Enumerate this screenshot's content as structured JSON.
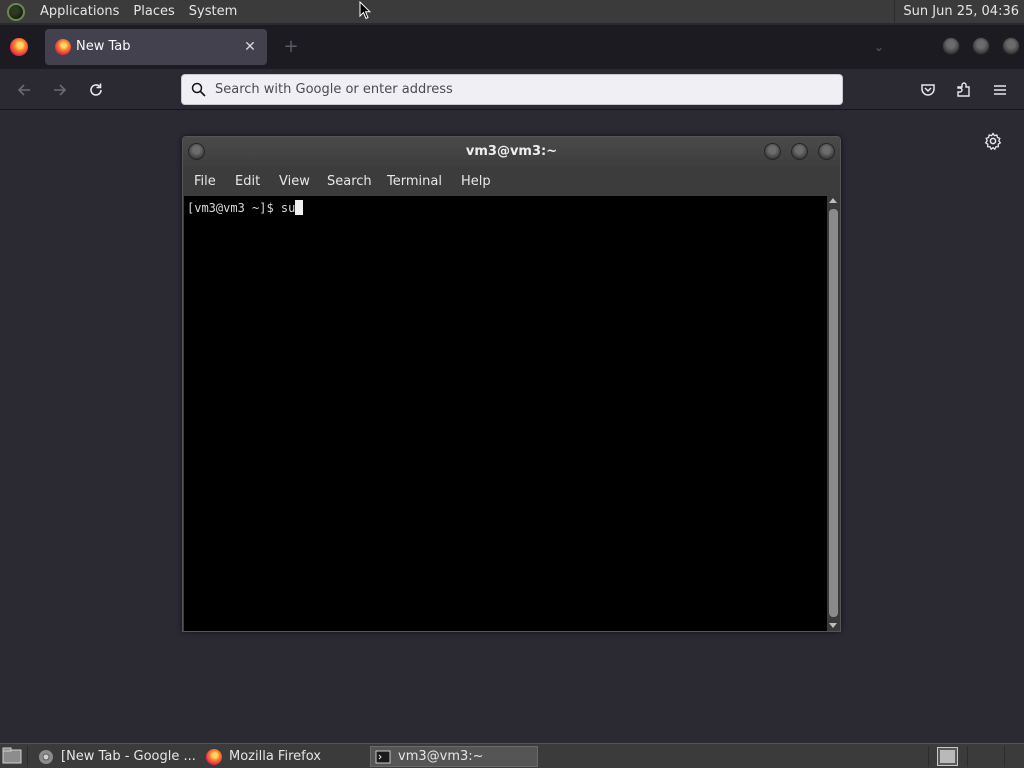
{
  "top_panel": {
    "menus": [
      "Applications",
      "Places",
      "System"
    ],
    "clock": "Sun Jun 25, 04:36"
  },
  "browser": {
    "tabs": [
      {
        "title": "New Tab",
        "close_icon": "close-icon",
        "active": true
      }
    ],
    "new_tab_label": "+",
    "url_bar": {
      "placeholder": "Search with Google or enter address",
      "value": ""
    },
    "icons": {
      "back": "arrow-left-icon",
      "forward": "arrow-right-icon",
      "reload": "reload-icon",
      "pocket": "pocket-icon",
      "extensions": "puzzle-icon",
      "menu": "hamburger-menu-icon",
      "page_settings": "gear-icon"
    }
  },
  "terminal": {
    "title": "vm3@vm3:~",
    "menu": [
      "File",
      "Edit",
      "View",
      "Search",
      "Terminal",
      "Help"
    ],
    "prompt": "[vm3@vm3 ~]$ ",
    "input": "su"
  },
  "taskbar": {
    "items": [
      {
        "label": "[New Tab - Google ...",
        "icon": "chrome-icon",
        "active": false
      },
      {
        "label": "Mozilla Firefox",
        "icon": "firefox-icon",
        "active": false
      },
      {
        "label": "vm3@vm3:~",
        "icon": "terminal-icon",
        "active": true
      }
    ]
  }
}
